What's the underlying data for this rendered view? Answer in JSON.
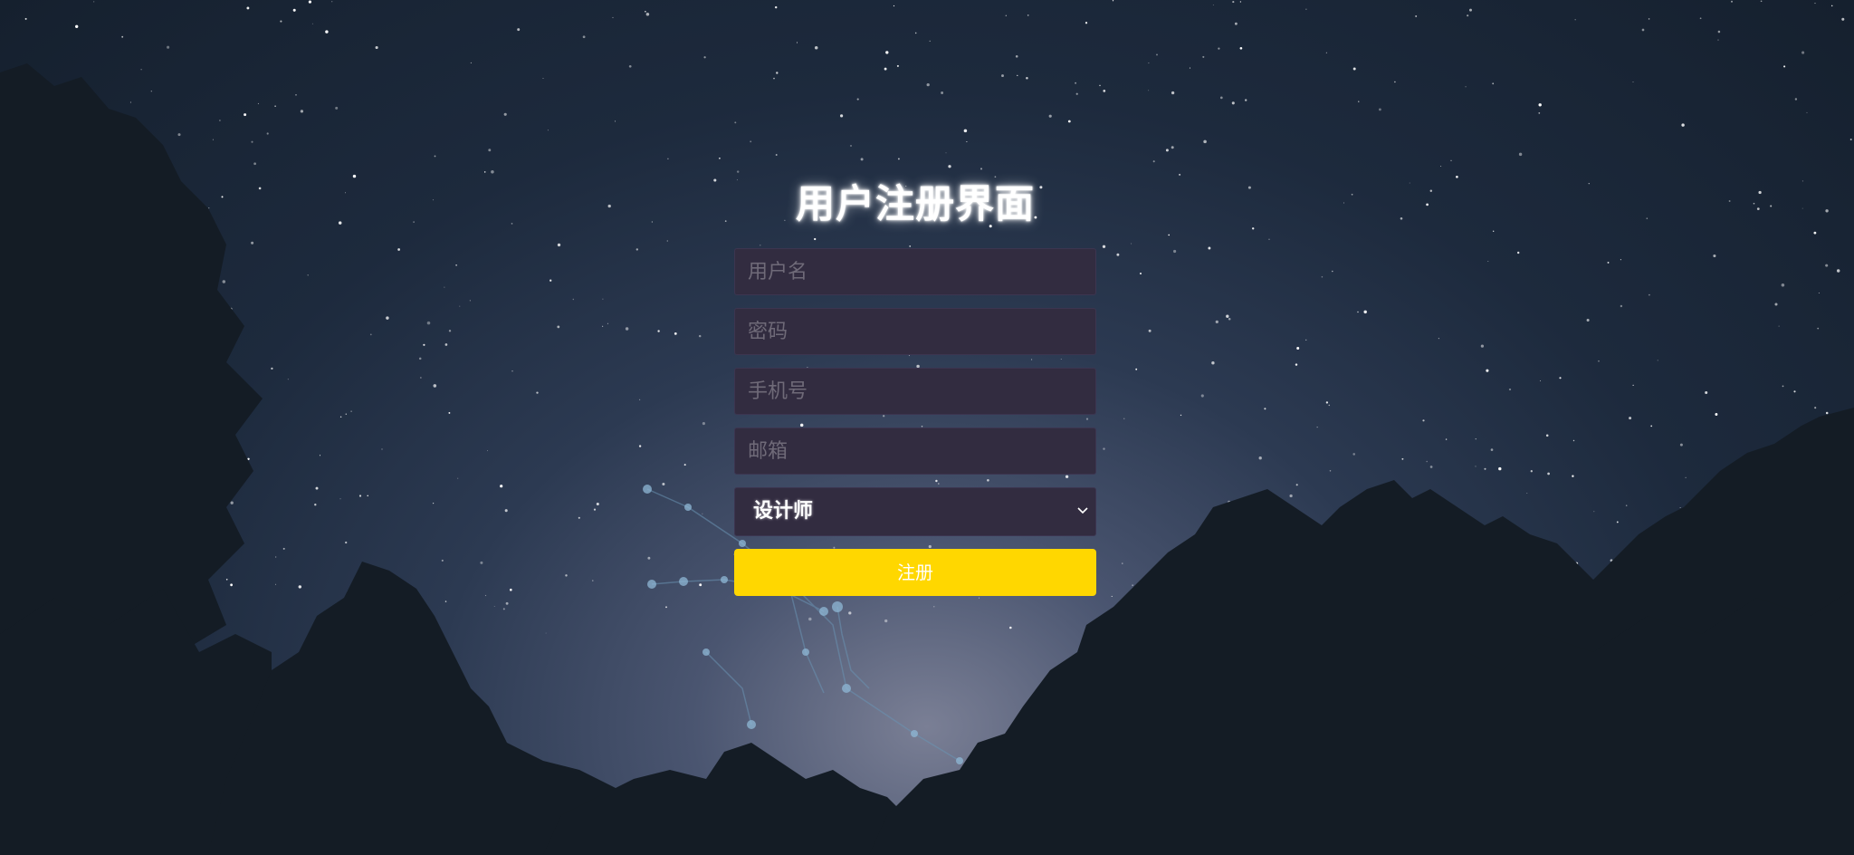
{
  "title": "用户注册界面",
  "form": {
    "username_placeholder": "用户名",
    "password_placeholder": "密码",
    "phone_placeholder": "手机号",
    "email_placeholder": "邮箱",
    "role_selected": "设计师",
    "submit_label": "注册"
  },
  "colors": {
    "accent": "#ffd700",
    "field_bg": "#322c40",
    "sky_dark": "#15202e",
    "tree_silhouette": "#141c25"
  },
  "icons": {
    "select_arrow": "chevron-down-icon"
  }
}
